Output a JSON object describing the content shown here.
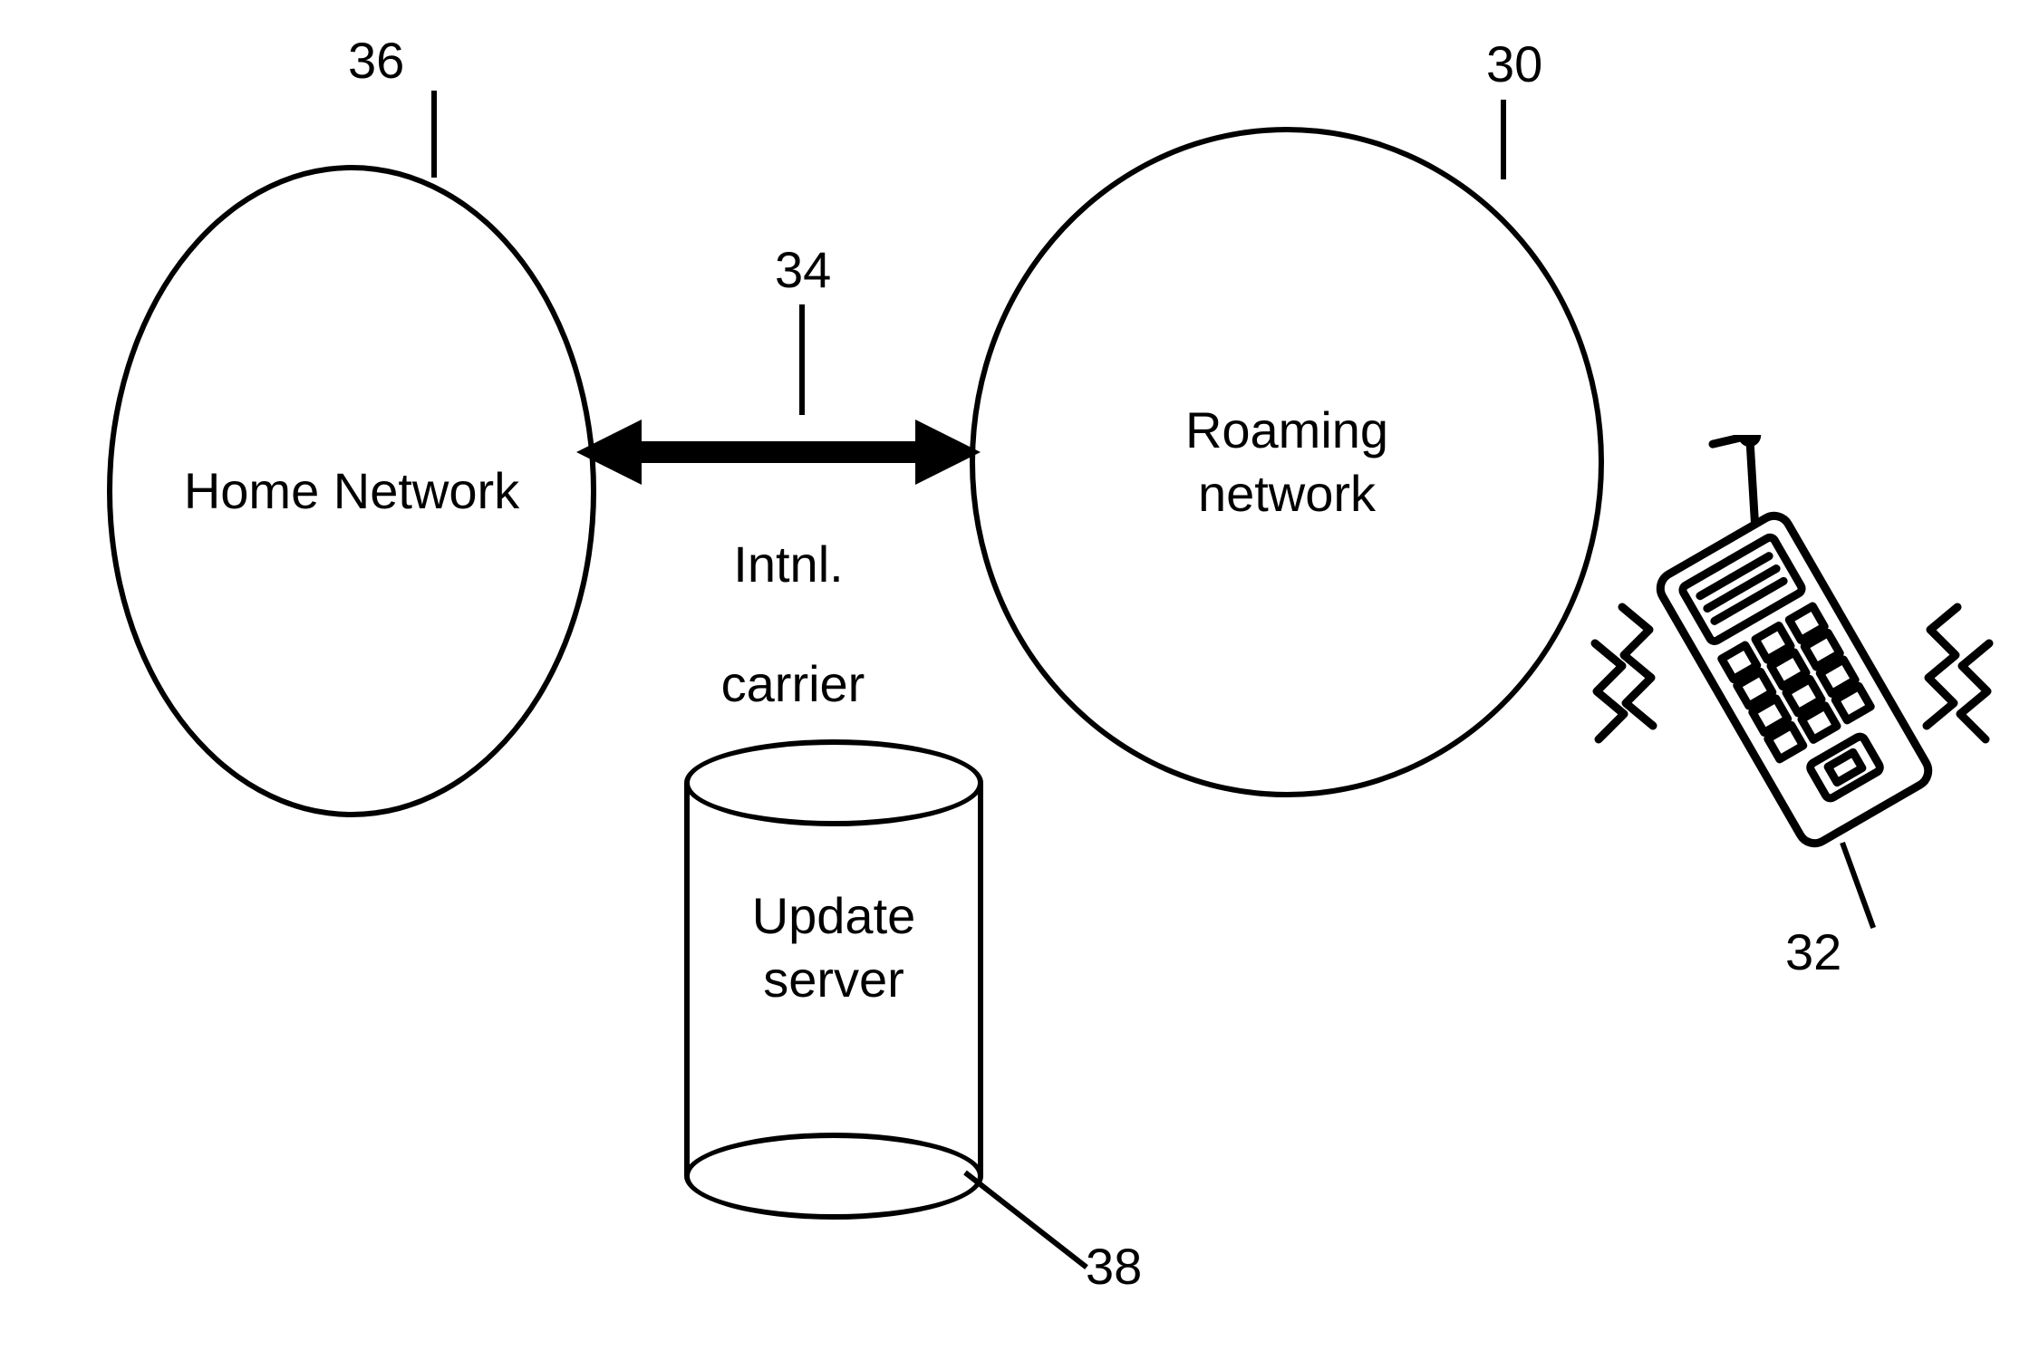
{
  "nodes": {
    "home_network": {
      "label": "Home Network",
      "ref": "36"
    },
    "roaming_network": {
      "label": "Roaming\nnetwork",
      "ref": "30"
    },
    "intl_carrier": {
      "label_line1": "Intnl.",
      "label_line2": "carrier",
      "ref": "34"
    },
    "update_server": {
      "label": "Update\nserver",
      "ref": "38"
    },
    "mobile_device": {
      "ref": "32"
    }
  }
}
